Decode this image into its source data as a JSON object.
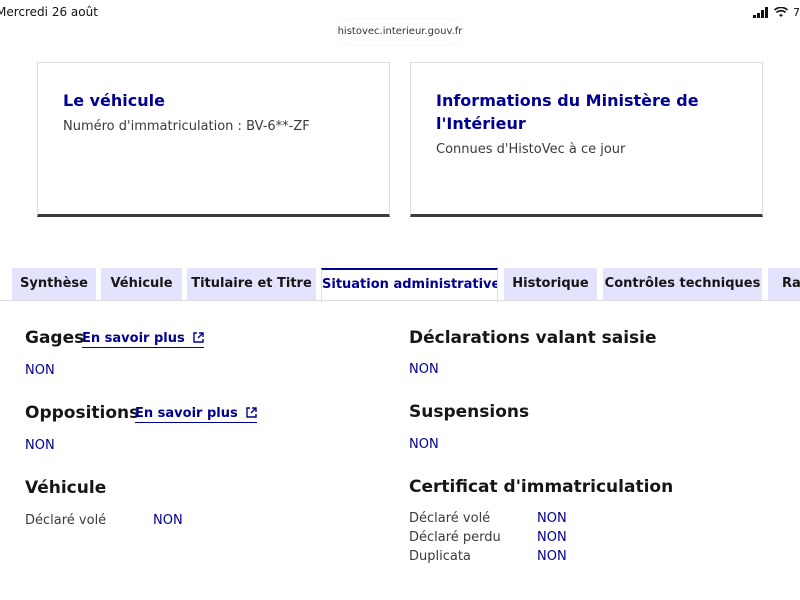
{
  "status_bar": {
    "date": "Mercredi 26 août",
    "battery_text": "7"
  },
  "browser": {
    "url": "histovec.interieur.gouv.fr"
  },
  "cards": [
    {
      "title": "Le véhicule",
      "description": "Numéro d'immatriculation : BV-6**-ZF"
    },
    {
      "title": "Informations du Ministère de l'Intérieur",
      "description": "Connues d'HistoVec à ce jour"
    }
  ],
  "tabs": [
    {
      "label": "Synthèse"
    },
    {
      "label": "Véhicule"
    },
    {
      "label": "Titulaire et Titre"
    },
    {
      "label": "Situation administrative",
      "active": true
    },
    {
      "label": "Historique"
    },
    {
      "label": "Contrôles techniques"
    },
    {
      "label": "Rap"
    }
  ],
  "left": {
    "gages": {
      "title": "Gages",
      "link": "En savoir plus",
      "value": "NON"
    },
    "oppositions": {
      "title": "Oppositions",
      "link": "En savoir plus",
      "value": "NON"
    },
    "vehicule": {
      "title": "Véhicule",
      "rows": [
        {
          "label": "Déclaré volé",
          "value": "NON"
        }
      ]
    }
  },
  "right": {
    "saisie": {
      "title": "Déclarations valant saisie",
      "value": "NON"
    },
    "suspensions": {
      "title": "Suspensions",
      "value": "NON"
    },
    "certificat": {
      "title": "Certificat d'immatriculation",
      "rows": [
        {
          "label": "Déclaré volé",
          "value": "NON"
        },
        {
          "label": "Déclaré perdu",
          "value": "NON"
        },
        {
          "label": "Duplicata",
          "value": "NON"
        }
      ]
    }
  },
  "colors": {
    "primary": "#000091",
    "tab_bg": "#e3e3fd",
    "text": "#161616"
  },
  "icons": {
    "external_link": "external-link-icon",
    "signal": "signal-icon",
    "wifi": "wifi-icon",
    "battery": "battery-icon"
  }
}
